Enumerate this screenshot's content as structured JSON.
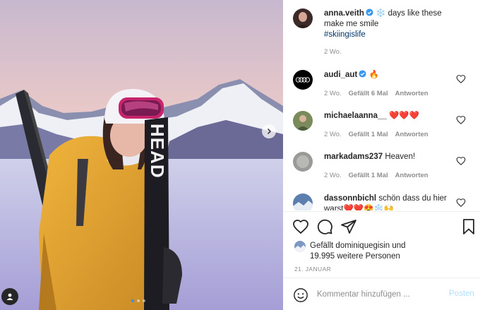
{
  "post": {
    "author": "anna.veith",
    "caption": "days like these make me smile",
    "hashtag": "#skiingislife",
    "time": "2 Wo.",
    "snowflake_emoji": "❄️"
  },
  "comments": [
    {
      "user": "audi_aut",
      "text": "🔥",
      "time": "2 Wo.",
      "likes": "Gefällt 6 Mal",
      "reply": "Antworten",
      "verified": true
    },
    {
      "user": "michaelaanna__",
      "text": "❤️❤️❤️",
      "time": "2 Wo.",
      "likes": "Gefällt 1 Mal",
      "reply": "Antworten"
    },
    {
      "user": "markadams237",
      "text": "Heaven!",
      "time": "2 Wo.",
      "likes": "Gefällt 1 Mal",
      "reply": "Antworten"
    },
    {
      "user": "dassonnbichl",
      "text": "schön dass du hier warst❤️❤️😍❄️🙌",
      "time": "",
      "likes": "",
      "reply": ""
    }
  ],
  "likes": {
    "line1": "Gefällt dominiquegisin und",
    "line2": "19.995 weitere Personen"
  },
  "date": "21. JANUAR",
  "comment_box": {
    "placeholder": "Kommentar hinzufügen ...",
    "post_label": "Posten"
  },
  "icons": [
    "heart-icon",
    "comment-icon",
    "share-icon",
    "bookmark-icon",
    "emoji-icon",
    "chevron-right-icon",
    "user-tag-icon",
    "verified-badge-icon"
  ],
  "colors": {
    "link": "#00376b",
    "meta": "#8e8e8e",
    "post_disabled": "#b2dffc",
    "verified": "#3897f0",
    "jacket": "#e8a83a"
  }
}
